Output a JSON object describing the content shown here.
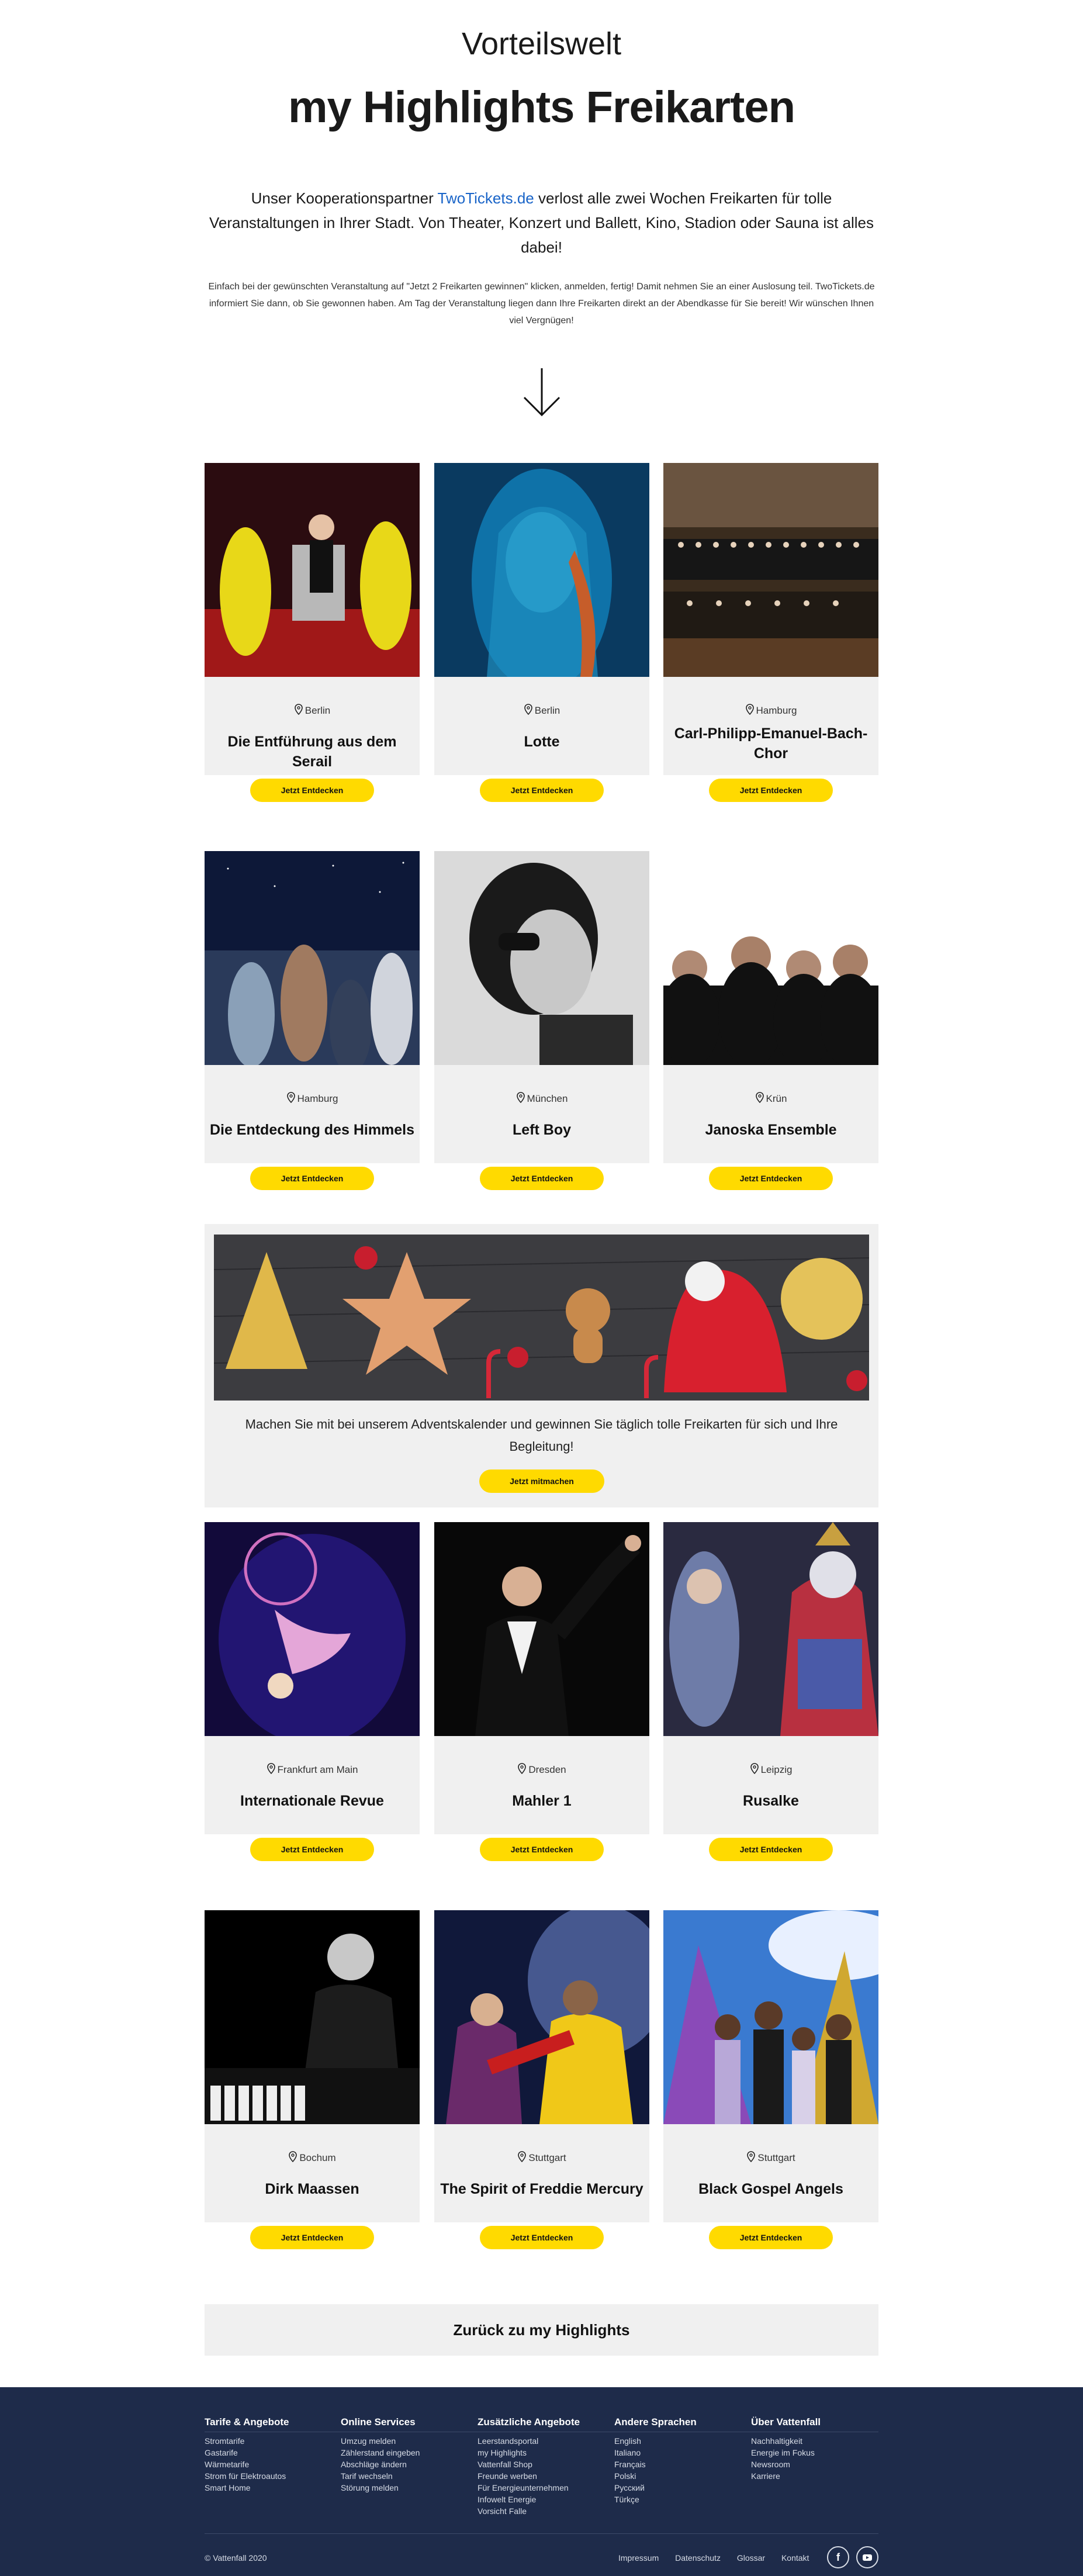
{
  "header": {
    "eyebrow": "Vorteilswelt",
    "title": "my Highlights Freikarten"
  },
  "intro": {
    "before_link": "Unser Kooperationspartner ",
    "link": "TwoTickets.de",
    "after_link": " verlost alle zwei Wochen Freikarten für tolle Veranstaltungen in Ihrer Stadt. Von Theater, Konzert und Ballett, Kino, Stadion oder Sauna ist alles dabei!",
    "small": "Einfach bei der gewünschten Veranstaltung auf \"Jetzt 2 Freikarten gewinnen\" klicken, anmelden, fertig! Damit nehmen Sie an einer Auslosung teil. TwoTickets.de informiert Sie dann, ob Sie gewonnen haben. Am Tag der Veranstaltung liegen dann Ihre Freikarten direkt an der Abendkasse für Sie bereit! Wir wünschen Ihnen viel Vergnügen!"
  },
  "icons": {
    "arrow": "arrow-down-icon",
    "pin": "location-pin-icon"
  },
  "colors": {
    "button": "#ffda00",
    "card_bg": "#f0f0f0",
    "footer_bg": "#1e2b4a",
    "link": "#1964c8"
  },
  "events": [
    {
      "city": "Berlin",
      "title": "Die Entführung aus dem Serail",
      "button": "Jetzt Entdecken"
    },
    {
      "city": "Berlin",
      "title": "Lotte",
      "button": "Jetzt Entdecken"
    },
    {
      "city": "Hamburg",
      "title": "Carl-Philipp-Emanuel-Bach-Chor",
      "button": "Jetzt Entdecken"
    },
    {
      "city": "Hamburg",
      "title": "Die Entdeckung des Himmels",
      "button": "Jetzt Entdecken"
    },
    {
      "city": "München",
      "title": "Left Boy",
      "button": "Jetzt Entdecken"
    },
    {
      "city": "Krün",
      "title": "Janoska Ensemble",
      "button": "Jetzt Entdecken"
    },
    {
      "city": "Frankfurt am Main",
      "title": "Internationale Revue",
      "button": "Jetzt Entdecken"
    },
    {
      "city": "Dresden",
      "title": "Mahler 1",
      "button": "Jetzt Entdecken"
    },
    {
      "city": "Leipzig",
      "title": "Rusalke",
      "button": "Jetzt Entdecken"
    },
    {
      "city": "Bochum",
      "title": "Dirk Maassen",
      "button": "Jetzt Entdecken"
    },
    {
      "city": "Stuttgart",
      "title": "The Spirit of Freddie Mercury",
      "button": "Jetzt Entdecken"
    },
    {
      "city": "Stuttgart",
      "title": "Black Gospel Angels",
      "button": "Jetzt Entdecken"
    }
  ],
  "advent": {
    "text": "Machen Sie mit bei unserem Adventskalender und gewinnen Sie täglich tolle Freikarten für sich und Ihre Begleitung!",
    "button": "Jetzt mitmachen"
  },
  "back": "Zurück zu my Highlights",
  "footer": {
    "columns": [
      {
        "title": "Tarife & Angebote",
        "items": [
          "Stromtarife",
          "Gastarife",
          "Wärmetarife",
          "Strom für Elektroautos",
          "Smart Home"
        ]
      },
      {
        "title": "Online Services",
        "items": [
          "Umzug melden",
          "Zählerstand eingeben",
          "Abschläge ändern",
          "Tarif wechseln",
          "Störung melden"
        ]
      },
      {
        "title": "Zusätzliche Angebote",
        "items": [
          "Leerstandsportal",
          "my Highlights",
          "Vattenfall Shop",
          "Freunde werben",
          "Für Energieunternehmen",
          "Infowelt Energie",
          "Vorsicht Falle"
        ]
      },
      {
        "title": "Andere Sprachen",
        "items": [
          "English",
          "Italiano",
          "Français",
          "Polski",
          "Русский",
          "Türkçe"
        ]
      },
      {
        "title": "Über Vattenfall",
        "items": [
          "Nachhaltigkeit",
          "Energie im Fokus",
          "Newsroom",
          "Karriere"
        ]
      }
    ],
    "copyright": "© Vattenfall 2020",
    "links": [
      "Impressum",
      "Datenschutz",
      "Glossar",
      "Kontakt"
    ],
    "social": [
      "facebook-icon",
      "youtube-icon"
    ]
  }
}
